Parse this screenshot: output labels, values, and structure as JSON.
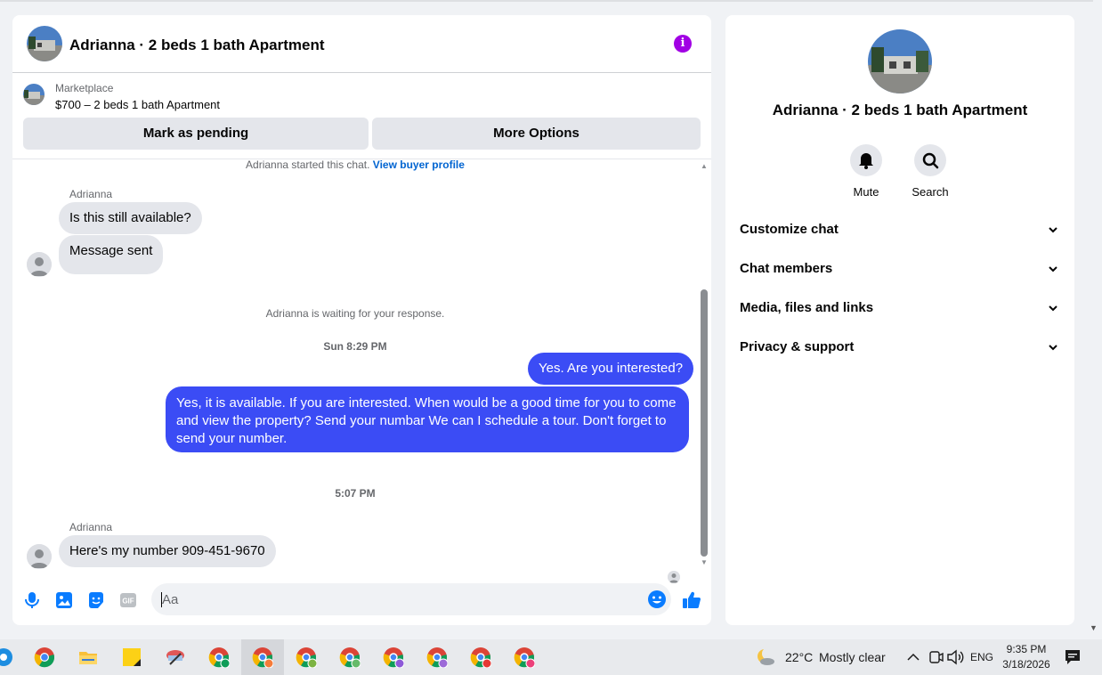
{
  "chat": {
    "title": "Adrianna · 2 beds 1 bath Apartment",
    "marketplace_label": "Marketplace",
    "listing": "$700 – 2 beds 1 bath Apartment",
    "mark_pending": "Mark as pending",
    "more_options": "More Options",
    "started_text": "Adrianna started this chat.",
    "view_buyer_profile": "View buyer profile",
    "sender1": "Adrianna",
    "msg1": "Is this still available?",
    "msg2": "Message sent",
    "waiting": "Adrianna is waiting for your response.",
    "time1": "Sun 8:29 PM",
    "out1": "Yes. Are you interested?",
    "out2": "Yes, it is available. If you are interested.   When would be a good time for you to come and view the property? Send your numbar We can I schedule a tour.  Don't forget to send your number.",
    "time2": "5:07 PM",
    "sender2": "Adrianna",
    "msg3": "Here's my number 909-451-9670",
    "input_placeholder": "Aa"
  },
  "info": {
    "title": "Adrianna · 2 beds 1 bath Apartment",
    "mute": "Mute",
    "search": "Search",
    "sections": [
      "Customize chat",
      "Chat members",
      "Media, files and links",
      "Privacy & support"
    ]
  },
  "taskbar": {
    "temp": "22°C",
    "weather": "Mostly clear",
    "lang": "ENG",
    "time": "9:35 PM",
    "date": "3/18/2026"
  },
  "colors": {
    "accent": "#3b4cf5",
    "info": "#a100e4",
    "icons": "#0a7cff"
  }
}
